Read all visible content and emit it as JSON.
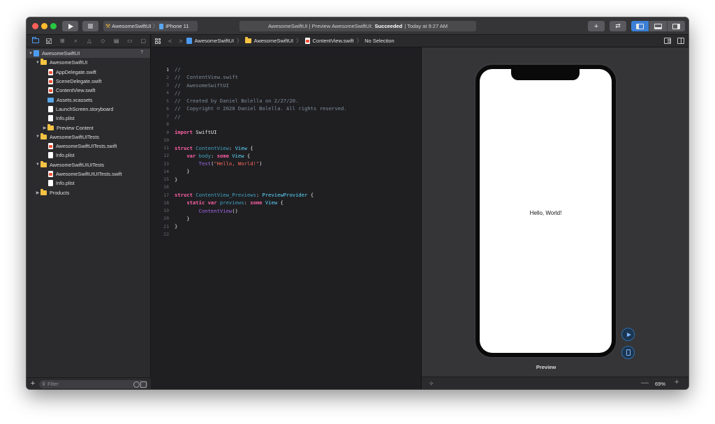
{
  "toolbar": {
    "scheme_name": "AwesomeSwiftUI",
    "scheme_separator": "〉",
    "device_name": "iPhone 11",
    "status_prefix": "AwesomeSwiftUI | Preview AwesomeSwiftUI:",
    "status_result": "Succeeded",
    "status_suffix": "| Today at 9:27 AM",
    "add_label": "+",
    "swap_label": "⇄"
  },
  "navigator": {
    "tree": [
      {
        "label": "AwesomeSwiftUI",
        "level": 0,
        "disclosure": "open",
        "icon": "project",
        "selected": true,
        "badge": "?"
      },
      {
        "label": "AwesomeSwiftUI",
        "level": 1,
        "disclosure": "open",
        "icon": "folder"
      },
      {
        "label": "AppDelegate.swift",
        "level": 2,
        "disclosure": "none",
        "icon": "swift-file"
      },
      {
        "label": "SceneDelegate.swift",
        "level": 2,
        "disclosure": "none",
        "icon": "swift-file"
      },
      {
        "label": "ContentView.swift",
        "level": 2,
        "disclosure": "none",
        "icon": "swift-file"
      },
      {
        "label": "Assets.xcassets",
        "level": 2,
        "disclosure": "none",
        "icon": "assets"
      },
      {
        "label": "LaunchScreen.storyboard",
        "level": 2,
        "disclosure": "none",
        "icon": "file"
      },
      {
        "label": "Info.plist",
        "level": 2,
        "disclosure": "none",
        "icon": "file"
      },
      {
        "label": "Preview Content",
        "level": 2,
        "disclosure": "closed",
        "icon": "folder"
      },
      {
        "label": "AwesomeSwiftUITests",
        "level": 1,
        "disclosure": "open",
        "icon": "folder"
      },
      {
        "label": "AwesomeSwiftUITests.swift",
        "level": 2,
        "disclosure": "none",
        "icon": "swift-file"
      },
      {
        "label": "Info.plist",
        "level": 2,
        "disclosure": "none",
        "icon": "file"
      },
      {
        "label": "AwesomeSwiftUIUITests",
        "level": 1,
        "disclosure": "open",
        "icon": "folder"
      },
      {
        "label": "AwesomeSwiftUIUITests.swift",
        "level": 2,
        "disclosure": "none",
        "icon": "swift-file"
      },
      {
        "label": "Info.plist",
        "level": 2,
        "disclosure": "none",
        "icon": "file"
      },
      {
        "label": "Products",
        "level": 1,
        "disclosure": "closed",
        "icon": "folder"
      }
    ],
    "add_label": "+",
    "filter_placeholder": "Filter"
  },
  "jumpbar": {
    "back_label": "<",
    "forward_label": ">",
    "crumbs": [
      {
        "label": "AwesomeSwiftUI",
        "icon": "project"
      },
      {
        "label": "AwesomeSwiftUI",
        "icon": "folder"
      },
      {
        "label": "ContentView.swift",
        "icon": "swift-file"
      },
      {
        "label": "No Selection",
        "icon": "none"
      }
    ]
  },
  "editor": {
    "current_line": 1,
    "lines": [
      [
        {
          "t": "//",
          "c": "comment"
        }
      ],
      [
        {
          "t": "//  ContentView.swift",
          "c": "comment"
        }
      ],
      [
        {
          "t": "//  AwesomeSwiftUI",
          "c": "comment"
        }
      ],
      [
        {
          "t": "//",
          "c": "comment"
        }
      ],
      [
        {
          "t": "//  Created by Daniel Bolella on 2/27/20.",
          "c": "comment"
        }
      ],
      [
        {
          "t": "//  Copyright © 2020 Daniel Bolella. All rights reserved.",
          "c": "comment"
        }
      ],
      [
        {
          "t": "//",
          "c": "comment"
        }
      ],
      [],
      [
        {
          "t": "import",
          "c": "kw"
        },
        {
          "t": " SwiftUI",
          "c": "plain"
        }
      ],
      [],
      [
        {
          "t": "struct",
          "c": "kw"
        },
        {
          "t": " ",
          "c": "plain"
        },
        {
          "t": "ContentView",
          "c": "decl"
        },
        {
          "t": ": ",
          "c": "plain"
        },
        {
          "t": "View",
          "c": "type"
        },
        {
          "t": " {",
          "c": "plain"
        }
      ],
      [
        {
          "t": "    ",
          "c": "plain"
        },
        {
          "t": "var",
          "c": "kw"
        },
        {
          "t": " ",
          "c": "plain"
        },
        {
          "t": "body",
          "c": "decl"
        },
        {
          "t": ": ",
          "c": "plain"
        },
        {
          "t": "some",
          "c": "kw"
        },
        {
          "t": " ",
          "c": "plain"
        },
        {
          "t": "View",
          "c": "type"
        },
        {
          "t": " {",
          "c": "plain"
        }
      ],
      [
        {
          "t": "        ",
          "c": "plain"
        },
        {
          "t": "Text",
          "c": "call"
        },
        {
          "t": "(",
          "c": "plain"
        },
        {
          "t": "\"Hello, World!\"",
          "c": "str"
        },
        {
          "t": ")",
          "c": "plain"
        }
      ],
      [
        {
          "t": "    }",
          "c": "plain"
        }
      ],
      [
        {
          "t": "}",
          "c": "plain"
        }
      ],
      [],
      [
        {
          "t": "struct",
          "c": "kw"
        },
        {
          "t": " ",
          "c": "plain"
        },
        {
          "t": "ContentView_Previews",
          "c": "decl"
        },
        {
          "t": ": ",
          "c": "plain"
        },
        {
          "t": "PreviewProvider",
          "c": "type"
        },
        {
          "t": " {",
          "c": "plain"
        }
      ],
      [
        {
          "t": "    ",
          "c": "plain"
        },
        {
          "t": "static",
          "c": "kw"
        },
        {
          "t": " ",
          "c": "plain"
        },
        {
          "t": "var",
          "c": "kw"
        },
        {
          "t": " ",
          "c": "plain"
        },
        {
          "t": "previews",
          "c": "decl"
        },
        {
          "t": ": ",
          "c": "plain"
        },
        {
          "t": "some",
          "c": "kw"
        },
        {
          "t": " ",
          "c": "plain"
        },
        {
          "t": "View",
          "c": "type"
        },
        {
          "t": " {",
          "c": "plain"
        }
      ],
      [
        {
          "t": "        ",
          "c": "plain"
        },
        {
          "t": "ContentView",
          "c": "call"
        },
        {
          "t": "()",
          "c": "plain"
        }
      ],
      [
        {
          "t": "    }",
          "c": "plain"
        }
      ],
      [
        {
          "t": "}",
          "c": "plain"
        }
      ],
      []
    ]
  },
  "canvas": {
    "preview_text": "Hello, World!",
    "preview_label": "Preview",
    "zoom_level": "69%",
    "zoom_minus": "—",
    "zoom_plus": "+"
  },
  "colors": {
    "accent": "#3c7fd6",
    "keyword": "#fc5fa3",
    "type": "#5dd8ff",
    "string": "#fc6a5d",
    "comment": "#7f8c98",
    "folder": "#f6c343"
  }
}
